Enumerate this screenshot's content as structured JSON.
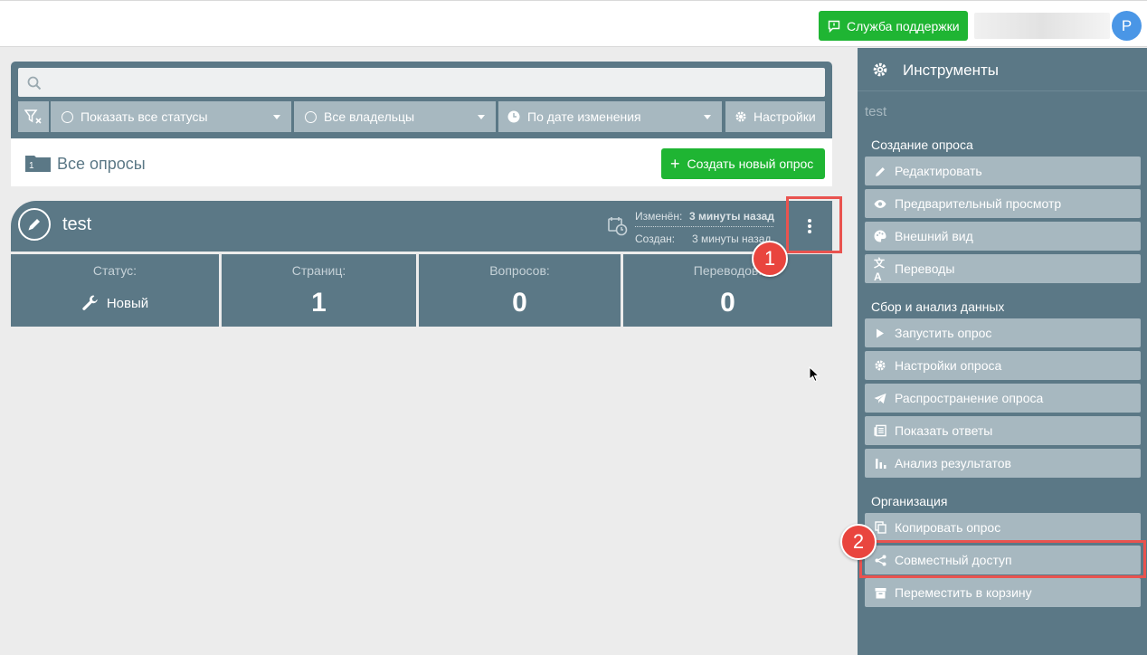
{
  "topbar": {
    "support_label": "Служба поддержки",
    "avatar_letter": "P"
  },
  "filters": {
    "search_placeholder": "",
    "statuses_label": "Показать все статусы",
    "owners_label": "Все владельцы",
    "sort_label": "По дате изменения",
    "settings_label": "Настройки"
  },
  "surveys_bar": {
    "folder_count": "1",
    "title": "Все опросы",
    "create_label": "Создать новый опрос"
  },
  "survey": {
    "title": "test",
    "modified_label": "Изменён:",
    "modified_value": "3 минуты назад",
    "created_label": "Создан:",
    "created_value": "3 минуты назад",
    "stats": [
      {
        "label": "Статус:",
        "value": "Новый"
      },
      {
        "label": "Страниц:",
        "value": "1"
      },
      {
        "label": "Вопросов:",
        "value": "0"
      },
      {
        "label": "Переводов:",
        "value": "0"
      }
    ]
  },
  "badges": [
    "1",
    "2"
  ],
  "sidebar": {
    "title": "Инструменты",
    "survey_name": "test",
    "groups": [
      {
        "title": "Создание опроса",
        "items": [
          "Редактировать",
          "Предварительный просмотр",
          "Внешний вид",
          "Переводы"
        ]
      },
      {
        "title": "Сбор и анализ данных",
        "items": [
          "Запустить опрос",
          "Настройки опроса",
          "Распространение опроса",
          "Показать ответы",
          "Анализ результатов"
        ]
      },
      {
        "title": "Организация",
        "items": [
          "Копировать опрос",
          "Совместный доступ",
          "Переместить в корзину"
        ]
      }
    ]
  },
  "colors": {
    "slate": "#5b7886",
    "slate_light": "#a7b8c0",
    "green": "#1fb533",
    "highlight_red": "#e9534f",
    "avatar_blue": "#4a96e6"
  }
}
